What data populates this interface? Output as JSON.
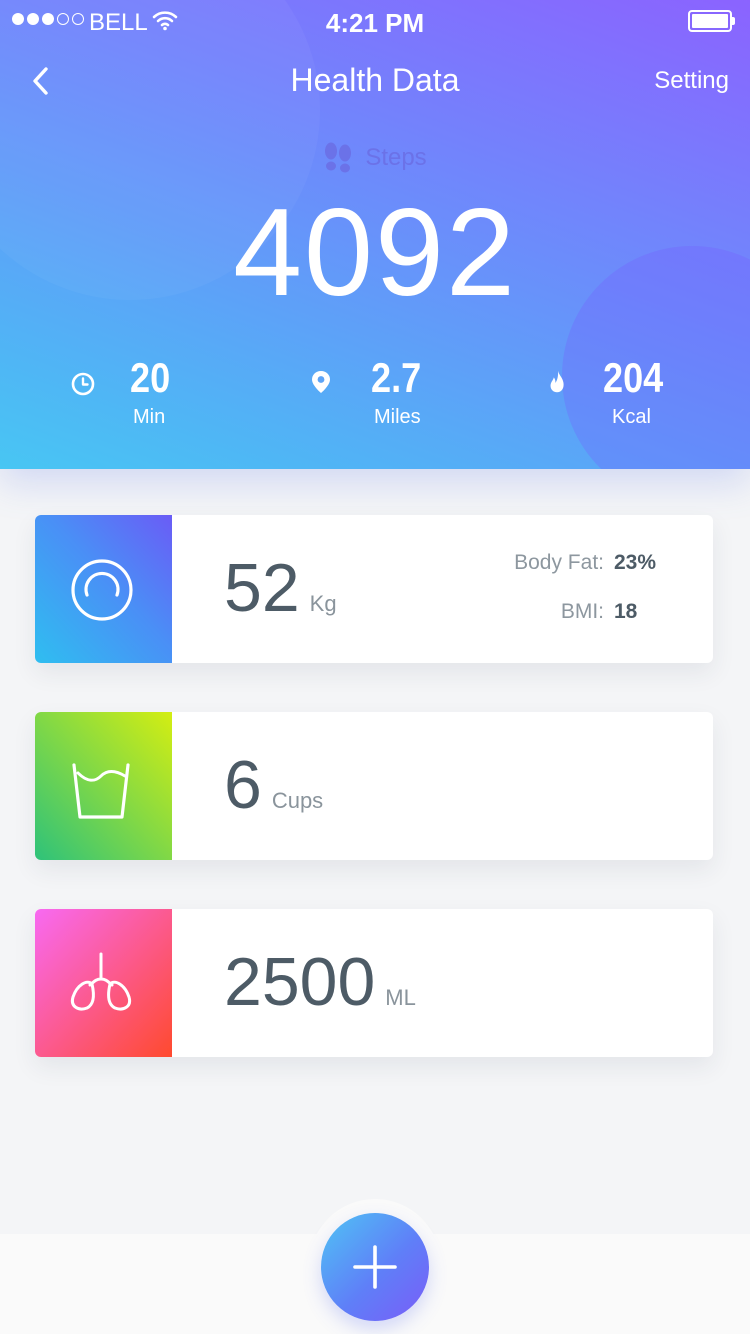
{
  "status_bar": {
    "carrier": "BELL",
    "time": "4:21 PM",
    "signal_bars_filled": 3,
    "signal_bars_total": 5
  },
  "header": {
    "title": "Health Data",
    "setting_label": "Setting",
    "back_icon": "chevron-left-icon"
  },
  "steps": {
    "label": "Steps",
    "icon": "footprints-icon",
    "value": "4092"
  },
  "stats": [
    {
      "icon": "clock-icon",
      "value": "20",
      "unit": "Min"
    },
    {
      "icon": "location-pin-icon",
      "value": "2.7",
      "unit": "Miles"
    },
    {
      "icon": "flame-icon",
      "value": "204",
      "unit": "Kcal"
    }
  ],
  "cards": {
    "weight": {
      "icon": "scale-gauge-icon",
      "value": "52",
      "unit": "Kg",
      "body_fat_label": "Body Fat:",
      "body_fat_value": "23%",
      "bmi_label": "BMI:",
      "bmi_value": "18"
    },
    "water": {
      "icon": "water-glass-icon",
      "value": "6",
      "unit": "Cups"
    },
    "lungs": {
      "icon": "lungs-icon",
      "value": "2500",
      "unit": "ML"
    }
  },
  "fab": {
    "icon": "plus-icon"
  },
  "colors": {
    "header_gradient_start": "#48c6f3",
    "header_gradient_end": "#8b63ff",
    "weight_tile": [
      "#4a8ff6",
      "#6a5cf6",
      "#2fbef0"
    ],
    "water_tile": [
      "#d4ee12",
      "#2ec27a"
    ],
    "lungs_tile": [
      "#f86af2",
      "#ff4a2e"
    ],
    "value_text": "#4d5b66"
  }
}
